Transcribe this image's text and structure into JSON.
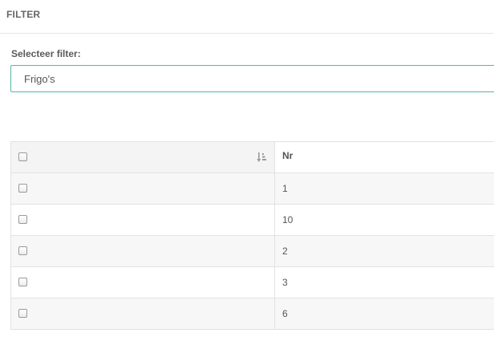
{
  "panel": {
    "title": "FILTER"
  },
  "filter": {
    "label": "Selecteer filter:",
    "selected": "Frigo's"
  },
  "table": {
    "columns": [
      "",
      "Nr"
    ],
    "rows": [
      {
        "nr": "1"
      },
      {
        "nr": "10"
      },
      {
        "nr": "2"
      },
      {
        "nr": "3"
      },
      {
        "nr": "6"
      }
    ]
  },
  "icons": {
    "sort": "sort-amount-icon"
  }
}
